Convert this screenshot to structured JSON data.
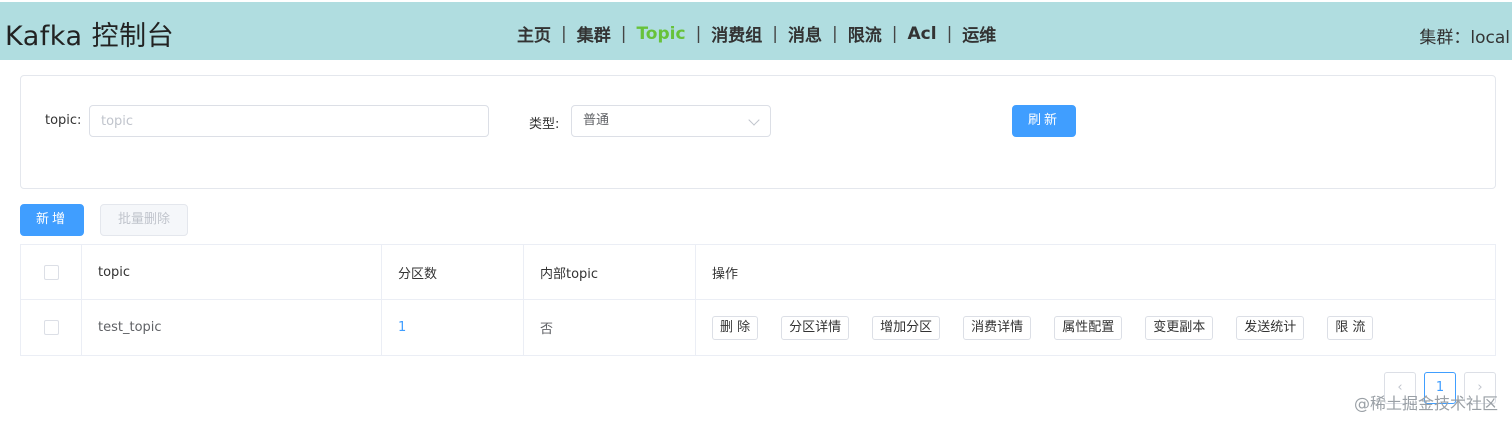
{
  "header": {
    "title": "Kafka 控制台",
    "nav": [
      {
        "label": "主页"
      },
      {
        "label": "集群"
      },
      {
        "label": "Topic",
        "active": true
      },
      {
        "label": "消费组"
      },
      {
        "label": "消息"
      },
      {
        "label": "限流"
      },
      {
        "label": "Acl"
      },
      {
        "label": "运维"
      }
    ],
    "nav_separator": "|",
    "cluster_text": "集群：local",
    "bg_color": "#b0dde0",
    "active_color": "#67c23a"
  },
  "filter": {
    "topic_label": "topic:",
    "topic_placeholder": "topic",
    "topic_value": "",
    "type_label": "类型:",
    "type_value": "普通",
    "refresh_label": "刷新"
  },
  "actions": {
    "add_label": "新增",
    "batch_delete_label": "批量删除"
  },
  "table": {
    "columns": [
      "topic",
      "分区数",
      "内部topic",
      "操作"
    ],
    "rows": [
      {
        "topic": "test_topic",
        "partitions": "1",
        "internal": "否",
        "operations": [
          "删 除",
          "分区详情",
          "增加分区",
          "消费详情",
          "属性配置",
          "变更副本",
          "发送统计",
          "限 流"
        ]
      }
    ]
  },
  "pagination": {
    "prev_icon": "‹",
    "current_page": "1",
    "next_icon": "›"
  },
  "watermark": "@稀土掘金技术社区",
  "colors": {
    "primary": "#409eff",
    "border": "#dcdfe6"
  }
}
